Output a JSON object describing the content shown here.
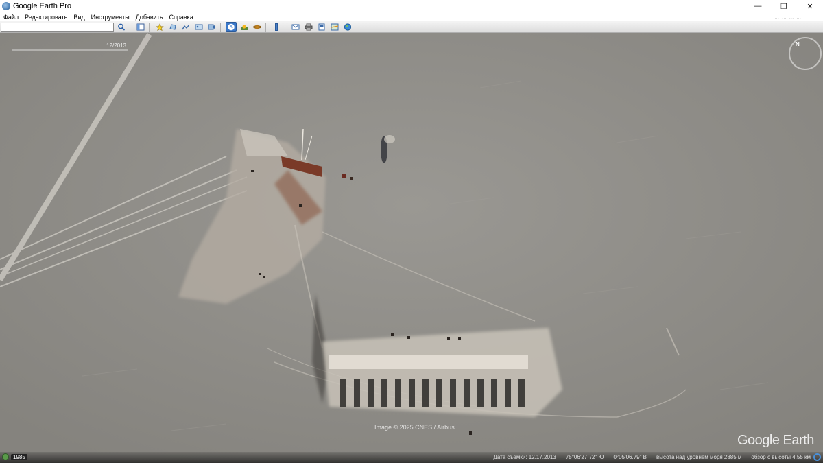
{
  "window": {
    "title": "Google Earth Pro",
    "minimize": "—",
    "maximize": "❐",
    "close": "✕"
  },
  "menu": {
    "items": [
      "Файл",
      "Редактировать",
      "Вид",
      "Инструменты",
      "Добавить",
      "Справка"
    ],
    "right_text": [
      "...",
      "...",
      "...",
      "..."
    ]
  },
  "toolbar": {
    "search_value": "",
    "buttons": [
      {
        "name": "search-button",
        "icon": "magnifier-icon"
      },
      {
        "name": "sidebar-toggle-button",
        "icon": "sidebar-icon"
      },
      {
        "name": "add-placemark-button",
        "icon": "pin-icon"
      },
      {
        "name": "add-polygon-button",
        "icon": "polygon-icon"
      },
      {
        "name": "add-path-button",
        "icon": "path-icon"
      },
      {
        "name": "add-overlay-button",
        "icon": "overlay-icon"
      },
      {
        "name": "record-tour-button",
        "icon": "tour-icon"
      },
      {
        "name": "historical-imagery-button",
        "icon": "clock-icon"
      },
      {
        "name": "sunlight-button",
        "icon": "sun-icon"
      },
      {
        "name": "planets-button",
        "icon": "planet-icon"
      },
      {
        "name": "ruler-button",
        "icon": "ruler-icon"
      },
      {
        "name": "email-button",
        "icon": "mail-icon"
      },
      {
        "name": "print-button",
        "icon": "printer-icon"
      },
      {
        "name": "save-image-button",
        "icon": "save-image-icon"
      },
      {
        "name": "view-in-maps-button",
        "icon": "maps-icon"
      },
      {
        "name": "earth-gallery-button",
        "icon": "globe-icon"
      }
    ]
  },
  "map": {
    "time_slider_date": "12/2013",
    "attribution": "Image © 2025 CNES / Airbus",
    "brand": "Google Earth"
  },
  "status": {
    "year": "1985",
    "date_label": "Дата съемки: 12.17.2013",
    "latitude": "75°06'27.72\" Ю",
    "longitude": "0°05'06.79\" В",
    "elevation": "высота над уровнем моря   2885 м",
    "eye_alt": "обзор с высоты    4.55 км"
  }
}
